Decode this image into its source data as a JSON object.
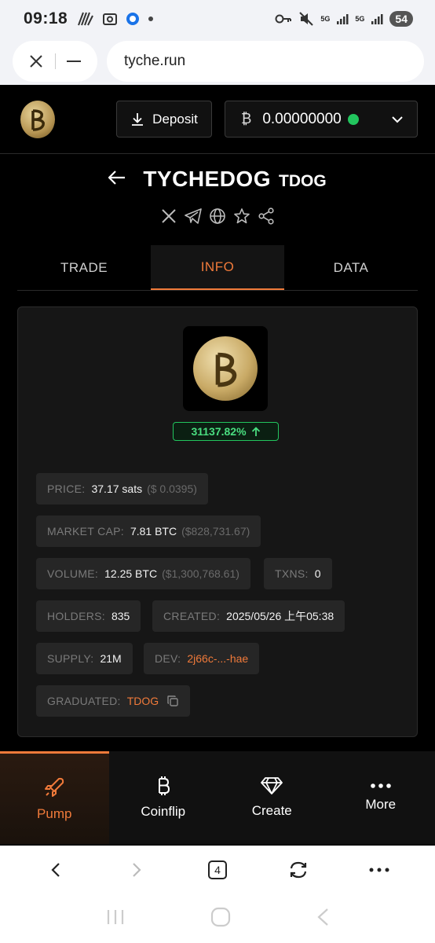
{
  "status_bar": {
    "time": "09:18",
    "network_1": "5G",
    "network_2": "5G",
    "battery": "54"
  },
  "browser": {
    "url": "tyche.run",
    "tab_count": "4"
  },
  "header": {
    "deposit_label": "Deposit",
    "balance_symbol": "₿",
    "balance": "0.00000000",
    "status_color": "#22c55e"
  },
  "token": {
    "name": "TYCHEDOG",
    "ticker": "TDOG",
    "change_pct": "31137.82%",
    "change_color": "#22c55e"
  },
  "tabs": [
    {
      "label": "TRADE",
      "active": false
    },
    {
      "label": "INFO",
      "active": true
    },
    {
      "label": "DATA",
      "active": false
    }
  ],
  "stats": {
    "price": {
      "label": "PRICE:",
      "value": "37.17 sats",
      "usd": "($ 0.0395)"
    },
    "market_cap": {
      "label": "MARKET CAP:",
      "value": "7.81 BTC",
      "usd": "($828,731.67)"
    },
    "volume": {
      "label": "VOLUME:",
      "value": "12.25 BTC",
      "usd": "($1,300,768.61)"
    },
    "txns": {
      "label": "TXNS:",
      "value": "0"
    },
    "holders": {
      "label": "HOLDERS:",
      "value": "835"
    },
    "created": {
      "label": "CREATED:",
      "value": "2025/05/26 上午05:38"
    },
    "supply": {
      "label": "SUPPLY:",
      "value": "21M"
    },
    "dev": {
      "label": "DEV:",
      "value": "2j66c-...-hae"
    },
    "graduated": {
      "label": "GRADUATED:",
      "value": "TDOG"
    }
  },
  "bottom_nav": [
    {
      "label": "Pump",
      "icon": "rocket-icon",
      "active": true
    },
    {
      "label": "Coinflip",
      "icon": "bitcoin-icon",
      "active": false
    },
    {
      "label": "Create",
      "icon": "diamond-icon",
      "active": false
    },
    {
      "label": "More",
      "icon": "more-dots-icon",
      "active": false
    }
  ],
  "accent_color": "#f07a3a"
}
